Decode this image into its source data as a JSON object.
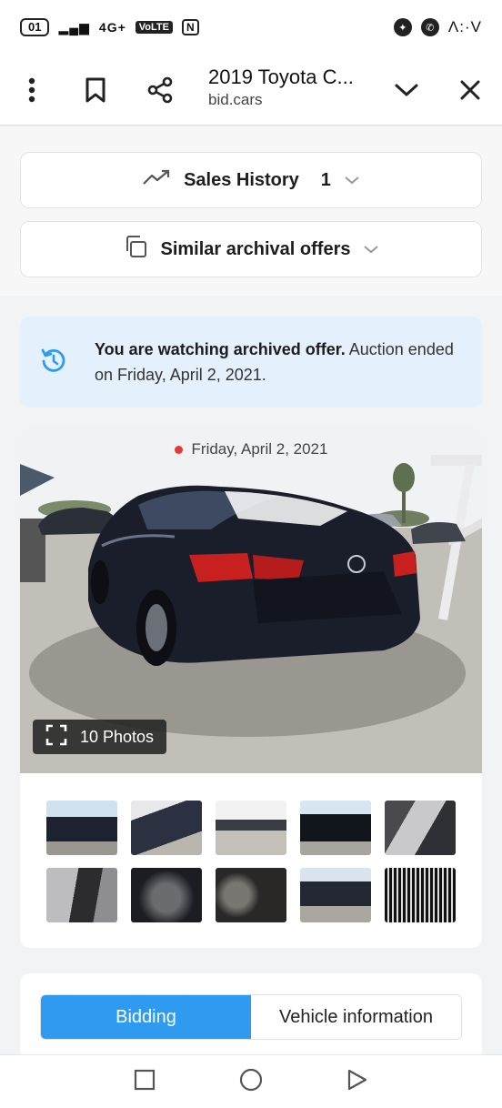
{
  "status_bar": {
    "battery": "01",
    "network": "4G+",
    "volte": "VoLTE",
    "nfc": "N",
    "time": "Λ:·V"
  },
  "browser": {
    "title": "2019 Toyota C...",
    "domain": "bid.cars",
    "icons": [
      "more-vert-icon",
      "bookmark-icon",
      "share-icon",
      "chevron-down-icon",
      "close-icon"
    ]
  },
  "sections": {
    "sales_history_label": "Sales History",
    "sales_history_count": "1",
    "similar_offers_label": "Similar archival offers"
  },
  "notice": {
    "bold": "You are watching archived offer.",
    "text": " Auction ended on Friday, April 2, 2021."
  },
  "listing": {
    "date": "Friday, April 2, 2021",
    "photos_label": "10 Photos",
    "thumbnail_count": 10
  },
  "tabs": {
    "bidding": "Bidding",
    "vehicle_information": "Vehicle information",
    "active": "Bidding"
  },
  "colors": {
    "accent": "#2e9bf0",
    "notice_bg": "#e4f1fc",
    "status_dot": "#e53935"
  }
}
